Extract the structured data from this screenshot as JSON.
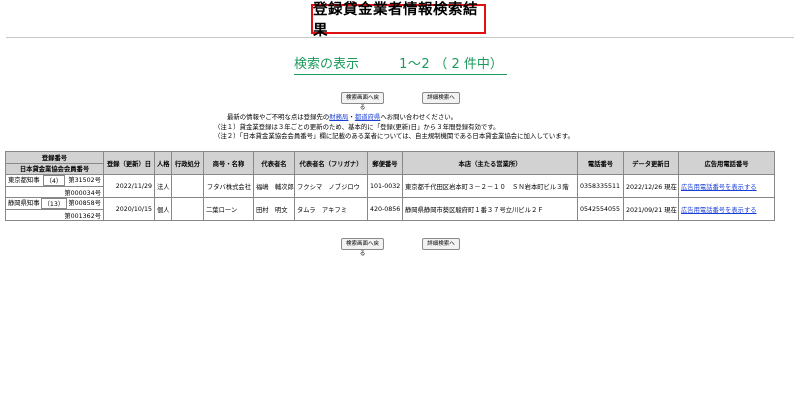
{
  "page_title": "登録貸金業者情報検索結果",
  "result": {
    "label": "検索の表示",
    "range": "1〜2",
    "count": "（ 2 件中）"
  },
  "buttons": {
    "back": "検索画面へ戻る",
    "detail": "詳細検索へ"
  },
  "notes": {
    "line1_pre": "最新の情報やご不明な点は登録先の",
    "line1_link1": "財務局",
    "line1_sep": "・",
    "line1_link2": "都道府県",
    "line1_post": "へお問い合わせください。",
    "line2": "（注１）貸金業登録は３年ごとの更新のため、基本的に「登録(更新)日」から３年間登録有効です。",
    "line3": "（注２）「日本貸金業協会会員番号」欄に記載のある業者については、自主規制機関である日本貸金業協会に加入しています。"
  },
  "table": {
    "headers": {
      "reg_no": "登録番号",
      "assoc_no": "日本貸金業協会会員番号",
      "reg_date": "登録（更新）日",
      "entity": "人格",
      "admin": "行政処分",
      "name": "商号・名称",
      "rep": "代表者名",
      "rep_kana": "代表者名（フリガナ）",
      "postal": "郵便番号",
      "address": "本店（主たる営業所）",
      "phone": "電話番号",
      "updated": "データ更新日",
      "ad_phone": "広告用電話番号"
    },
    "rows": [
      {
        "reg_authority": "東京都知事",
        "reg_count": "（4）",
        "reg_no": "第31502号",
        "assoc_no": "第000034号",
        "reg_date": "2022/11/29",
        "entity": "法人",
        "admin": "",
        "name": "フタバ株式会社",
        "rep": "福嶋　輔次郎",
        "rep_kana": "フクシマ　ノブジロウ",
        "postal": "101-0032",
        "address": "東京都千代田区岩本町３－２－１０　ＳＮ岩本町ビル３階",
        "phone": "0358335511",
        "updated": "2022/12/26 現在",
        "ad_link": "広告用電話番号を表示する"
      },
      {
        "reg_authority": "静岡県知事",
        "reg_count": "（13）",
        "reg_no": "第00858号",
        "assoc_no": "第001362号",
        "reg_date": "2020/10/15",
        "entity": "個人",
        "admin": "",
        "name": "二葉ローン",
        "rep": "田村　明文",
        "rep_kana": "タムラ　アキフミ",
        "postal": "420-0856",
        "address": "静岡県静岡市葵区駿府町１番３７号立川ビル２Ｆ",
        "phone": "0542554055",
        "updated": "2021/09/21 現在",
        "ad_link": "広告用電話番号を表示する"
      }
    ]
  }
}
